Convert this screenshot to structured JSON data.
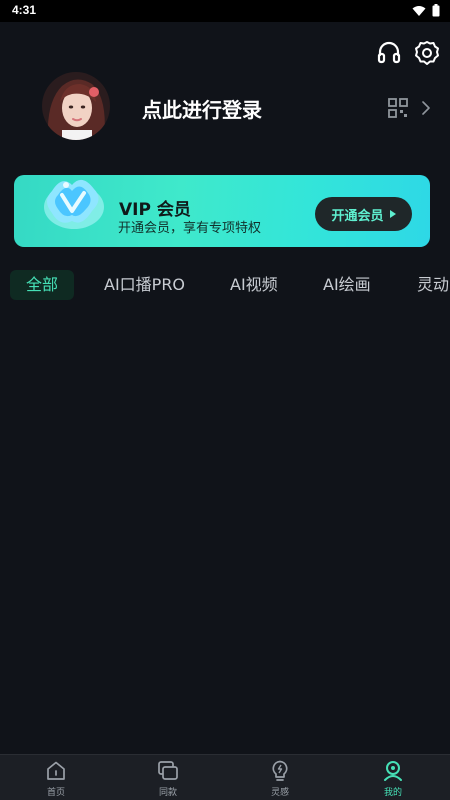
{
  "status_bar": {
    "time": "4:31"
  },
  "header": {
    "icons": [
      "headset-icon",
      "gear-icon"
    ]
  },
  "profile": {
    "login_prompt": "点此进行登录",
    "qr_icon": "qr-code-icon"
  },
  "vip": {
    "title": "VIP 会员",
    "subtitle": "开通会员，享有专项特权",
    "button_label": "开通会员",
    "accent_color": "#3fe9cb"
  },
  "tabs": [
    {
      "label": "全部",
      "active": true
    },
    {
      "label": "AI口播PRO",
      "active": false
    },
    {
      "label": "AI视频",
      "active": false
    },
    {
      "label": "AI绘画",
      "active": false
    },
    {
      "label": "灵动",
      "active": false
    }
  ],
  "bottom_nav": [
    {
      "label": "首页",
      "icon": "home-icon",
      "active": false
    },
    {
      "label": "同款",
      "icon": "copy-icon",
      "active": false
    },
    {
      "label": "灵感",
      "icon": "lightbulb-icon",
      "active": false
    },
    {
      "label": "我的",
      "icon": "profile-icon",
      "active": true
    }
  ],
  "colors": {
    "background": "#101319",
    "accent": "#46e0b6"
  }
}
